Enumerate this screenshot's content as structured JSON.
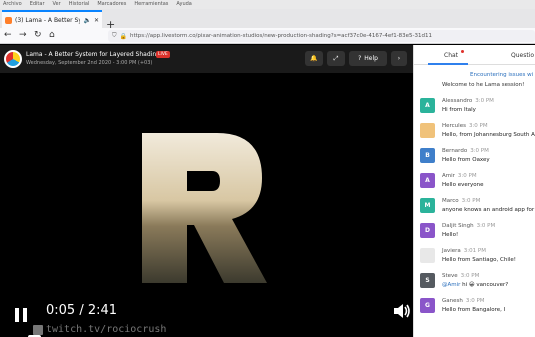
{
  "os_menu": [
    "Archivo",
    "Editar",
    "Ver",
    "Historial",
    "Marcadores",
    "Herramientas",
    "Ayuda"
  ],
  "browser": {
    "tab_title": "(3) Lama - A Better System",
    "new_tab": "+",
    "url": "https://app.livestorm.co/pixar-animation-studios/new-production-shading?s=acf37c0e-4167-4ef1-83e5-31d11"
  },
  "video_header": {
    "title": "Lama - A Better System for Layered Shading",
    "badge": "LIVE",
    "subtitle": "Wednesday, September 2nd 2020 - 3:00 PM (+03)",
    "help_label": "Help"
  },
  "player": {
    "time_current": "0:05",
    "time_total": "2:41",
    "watermark": "twitch.tv/rociocrush",
    "progress": 0.031
  },
  "chat": {
    "tab_chat": "Chat",
    "tab_questions": "Questio",
    "notice": "Encountering issues wi",
    "first_message": "Welcome to he Lama session!",
    "messages": [
      {
        "initial": "A",
        "name": "Alessandro",
        "time": "3:0 PM",
        "text": "Hi from Italy",
        "color": "#2bb39b"
      },
      {
        "initial": "",
        "name": "Hercules",
        "time": "3:0 PM",
        "text": "Hello, from Johannesburg South A",
        "color": "#f0c27a"
      },
      {
        "initial": "B",
        "name": "Bernardo",
        "time": "3:0 PM",
        "text": "Hello from Oaxey",
        "color": "#3f7fca"
      },
      {
        "initial": "A",
        "name": "Amir",
        "time": "3:0 PM",
        "text": "Hello everyone",
        "color": "#8a55c9"
      },
      {
        "initial": "M",
        "name": "Marco",
        "time": "3:0 PM",
        "text": "anyone knows an android app for",
        "color": "#2bb39b"
      },
      {
        "initial": "D",
        "name": "Daljit Singh",
        "time": "3:0 PM",
        "text": "Hello!",
        "color": "#8a55c9"
      },
      {
        "initial": "",
        "name": "Javiera",
        "time": "3:01 PM",
        "text": "Hello from Santiago, Chile!",
        "color": "#e8e8e8"
      },
      {
        "initial": "S",
        "name": "Steve",
        "time": "3:0 PM",
        "mention": "@Amir",
        "text": " hi 😀 vancouver?",
        "color": "#555a60"
      },
      {
        "initial": "G",
        "name": "Ganesh",
        "time": "3:0 PM",
        "text": "Hello from Bangalore, I",
        "color": "#8a55c9"
      }
    ]
  }
}
